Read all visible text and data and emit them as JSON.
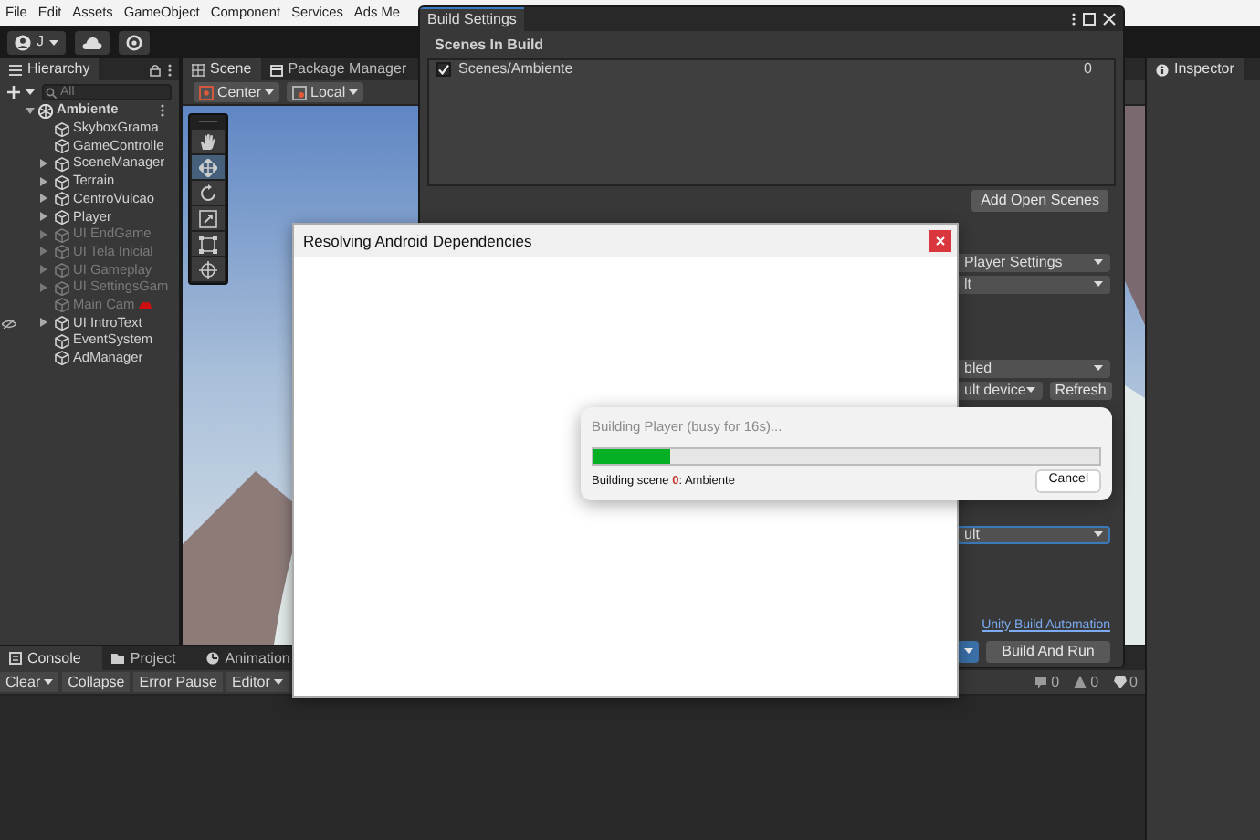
{
  "menu_bar": {
    "items": [
      "File",
      "Edit",
      "Assets",
      "GameObject",
      "Component",
      "Services",
      "Ads Me"
    ]
  },
  "account": {
    "initial": "J"
  },
  "hierarchy": {
    "title": "Hierarchy",
    "search": {
      "placeholder": "All"
    },
    "root": {
      "label": "Ambiente",
      "expanded": true,
      "children": [
        {
          "label": "SkyboxGrama",
          "expandable": false,
          "disabled": false,
          "scene_hidden": false
        },
        {
          "label": "GameControlle",
          "expandable": false,
          "disabled": false,
          "scene_hidden": false
        },
        {
          "label": "SceneManager",
          "expandable": true,
          "disabled": false,
          "scene_hidden": false
        },
        {
          "label": "Terrain",
          "expandable": true,
          "disabled": false,
          "scene_hidden": false
        },
        {
          "label": "CentroVulcao",
          "expandable": true,
          "disabled": false,
          "scene_hidden": false
        },
        {
          "label": "Player",
          "expandable": true,
          "disabled": false,
          "scene_hidden": false
        },
        {
          "label": "UI EndGame",
          "expandable": true,
          "disabled": true,
          "scene_hidden": false
        },
        {
          "label": "UI Tela Inicial",
          "expandable": true,
          "disabled": true,
          "scene_hidden": false
        },
        {
          "label": "UI Gameplay",
          "expandable": true,
          "disabled": true,
          "scene_hidden": false
        },
        {
          "label": "UI SettingsGam",
          "expandable": true,
          "disabled": true,
          "scene_hidden": false
        },
        {
          "label": "Main Cam",
          "expandable": false,
          "disabled": true,
          "scene_hidden": false
        },
        {
          "label": "UI IntroText",
          "expandable": true,
          "disabled": false,
          "scene_hidden": true
        },
        {
          "label": "EventSystem",
          "expandable": false,
          "disabled": false,
          "scene_hidden": false
        },
        {
          "label": "AdManager",
          "expandable": false,
          "disabled": false,
          "scene_hidden": false
        }
      ]
    }
  },
  "scene_tabs": [
    {
      "label": "Scene",
      "selected": true
    },
    {
      "label": "Package Manager",
      "selected": false
    }
  ],
  "scene_toolbar": {
    "pivot": "Center",
    "space": "Local"
  },
  "tool_palette": [
    {
      "kind": "hand",
      "selected": false
    },
    {
      "kind": "move",
      "selected": true
    },
    {
      "kind": "rotate",
      "selected": false
    },
    {
      "kind": "scale",
      "selected": false
    },
    {
      "kind": "rect",
      "selected": false
    },
    {
      "kind": "transform",
      "selected": false
    }
  ],
  "inspector": {
    "title": "Inspector"
  },
  "bottom_panel": {
    "tabs": [
      {
        "label": "Console",
        "selected": true
      },
      {
        "label": "Project",
        "selected": false
      },
      {
        "label": "Animation",
        "selected": false
      }
    ],
    "toolbar": [
      {
        "label": "Clear",
        "dropdown": true
      },
      {
        "label": "Collapse",
        "dropdown": false
      },
      {
        "label": "Error Pause",
        "dropdown": false
      },
      {
        "label": "Editor",
        "dropdown": true
      }
    ],
    "counts": [
      {
        "kind": "log",
        "value": "0"
      },
      {
        "kind": "warning",
        "value": "0"
      },
      {
        "kind": "error",
        "value": "0"
      }
    ]
  },
  "build_settings": {
    "title": "Build Settings",
    "scenes_heading": "Scenes In Build",
    "scenes": [
      {
        "path": "Scenes/Ambiente",
        "checked": true,
        "index": "0"
      }
    ],
    "add_open_scenes": "Add Open Scenes",
    "dropdown_1": "Player Settings",
    "dropdown_2": "lt",
    "dropdown_3": "bled",
    "dropdown_4": "ult device",
    "refresh": "Refresh",
    "dropdown_5": "ult",
    "link": "Unity Build Automation",
    "build_and_run": "Build And Run"
  },
  "resolving_dialog": {
    "title": "Resolving Android Dependencies"
  },
  "progress_dialog": {
    "title": "Building Player (busy for 16s)...",
    "level": 0.15,
    "status": "Building scene **0**: Ambiente",
    "cancel": "Cancel"
  }
}
